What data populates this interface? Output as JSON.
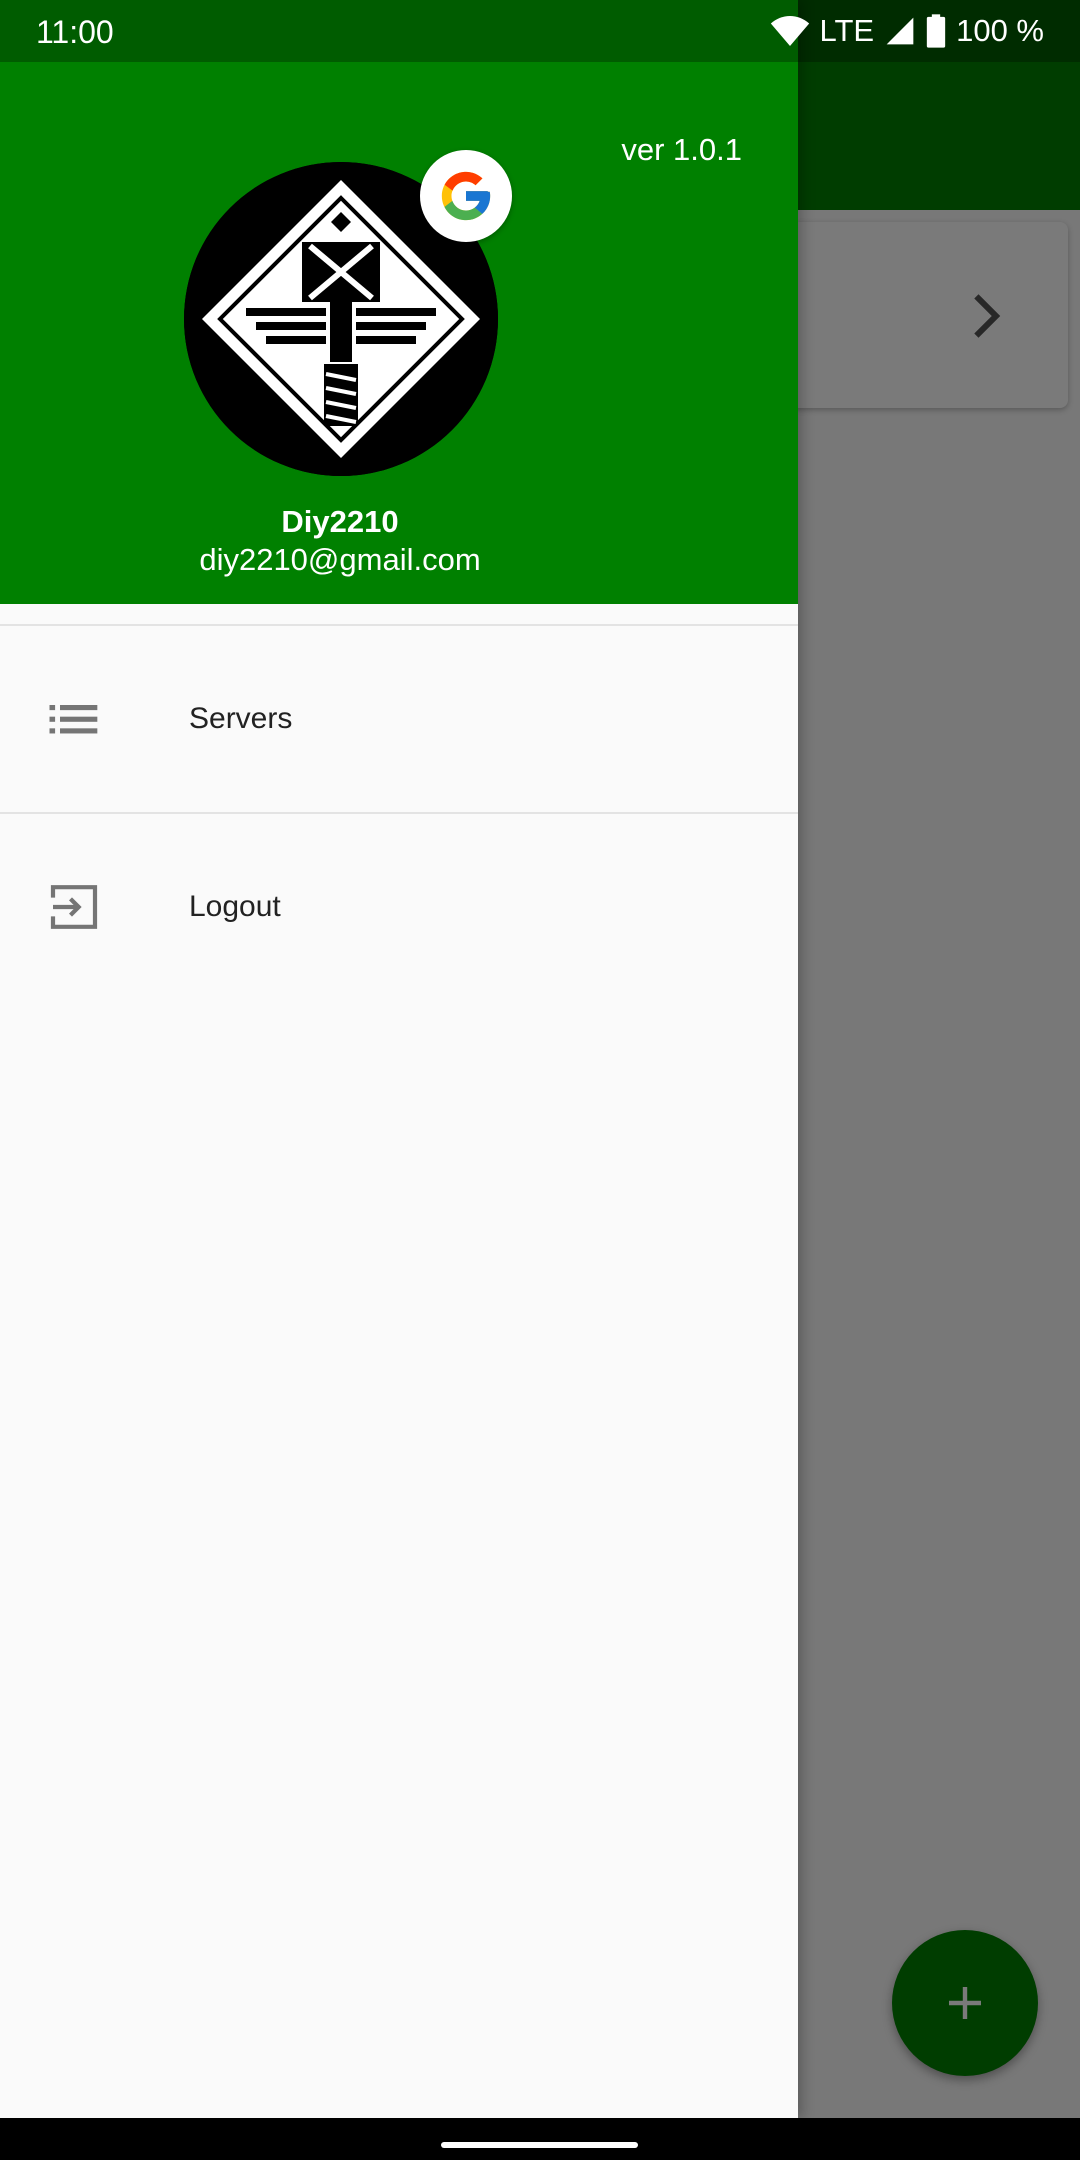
{
  "status_bar": {
    "time": "11:00",
    "network": "LTE",
    "battery": "100 %"
  },
  "drawer": {
    "version": "ver 1.0.1",
    "user_name": "Diy2210",
    "user_email": "diy2210@gmail.com",
    "items": [
      {
        "label": "Servers",
        "icon": "list-icon"
      },
      {
        "label": "Logout",
        "icon": "logout-icon"
      }
    ]
  },
  "colors": {
    "primary": "#008000",
    "drawer_background": "#fafafa"
  }
}
